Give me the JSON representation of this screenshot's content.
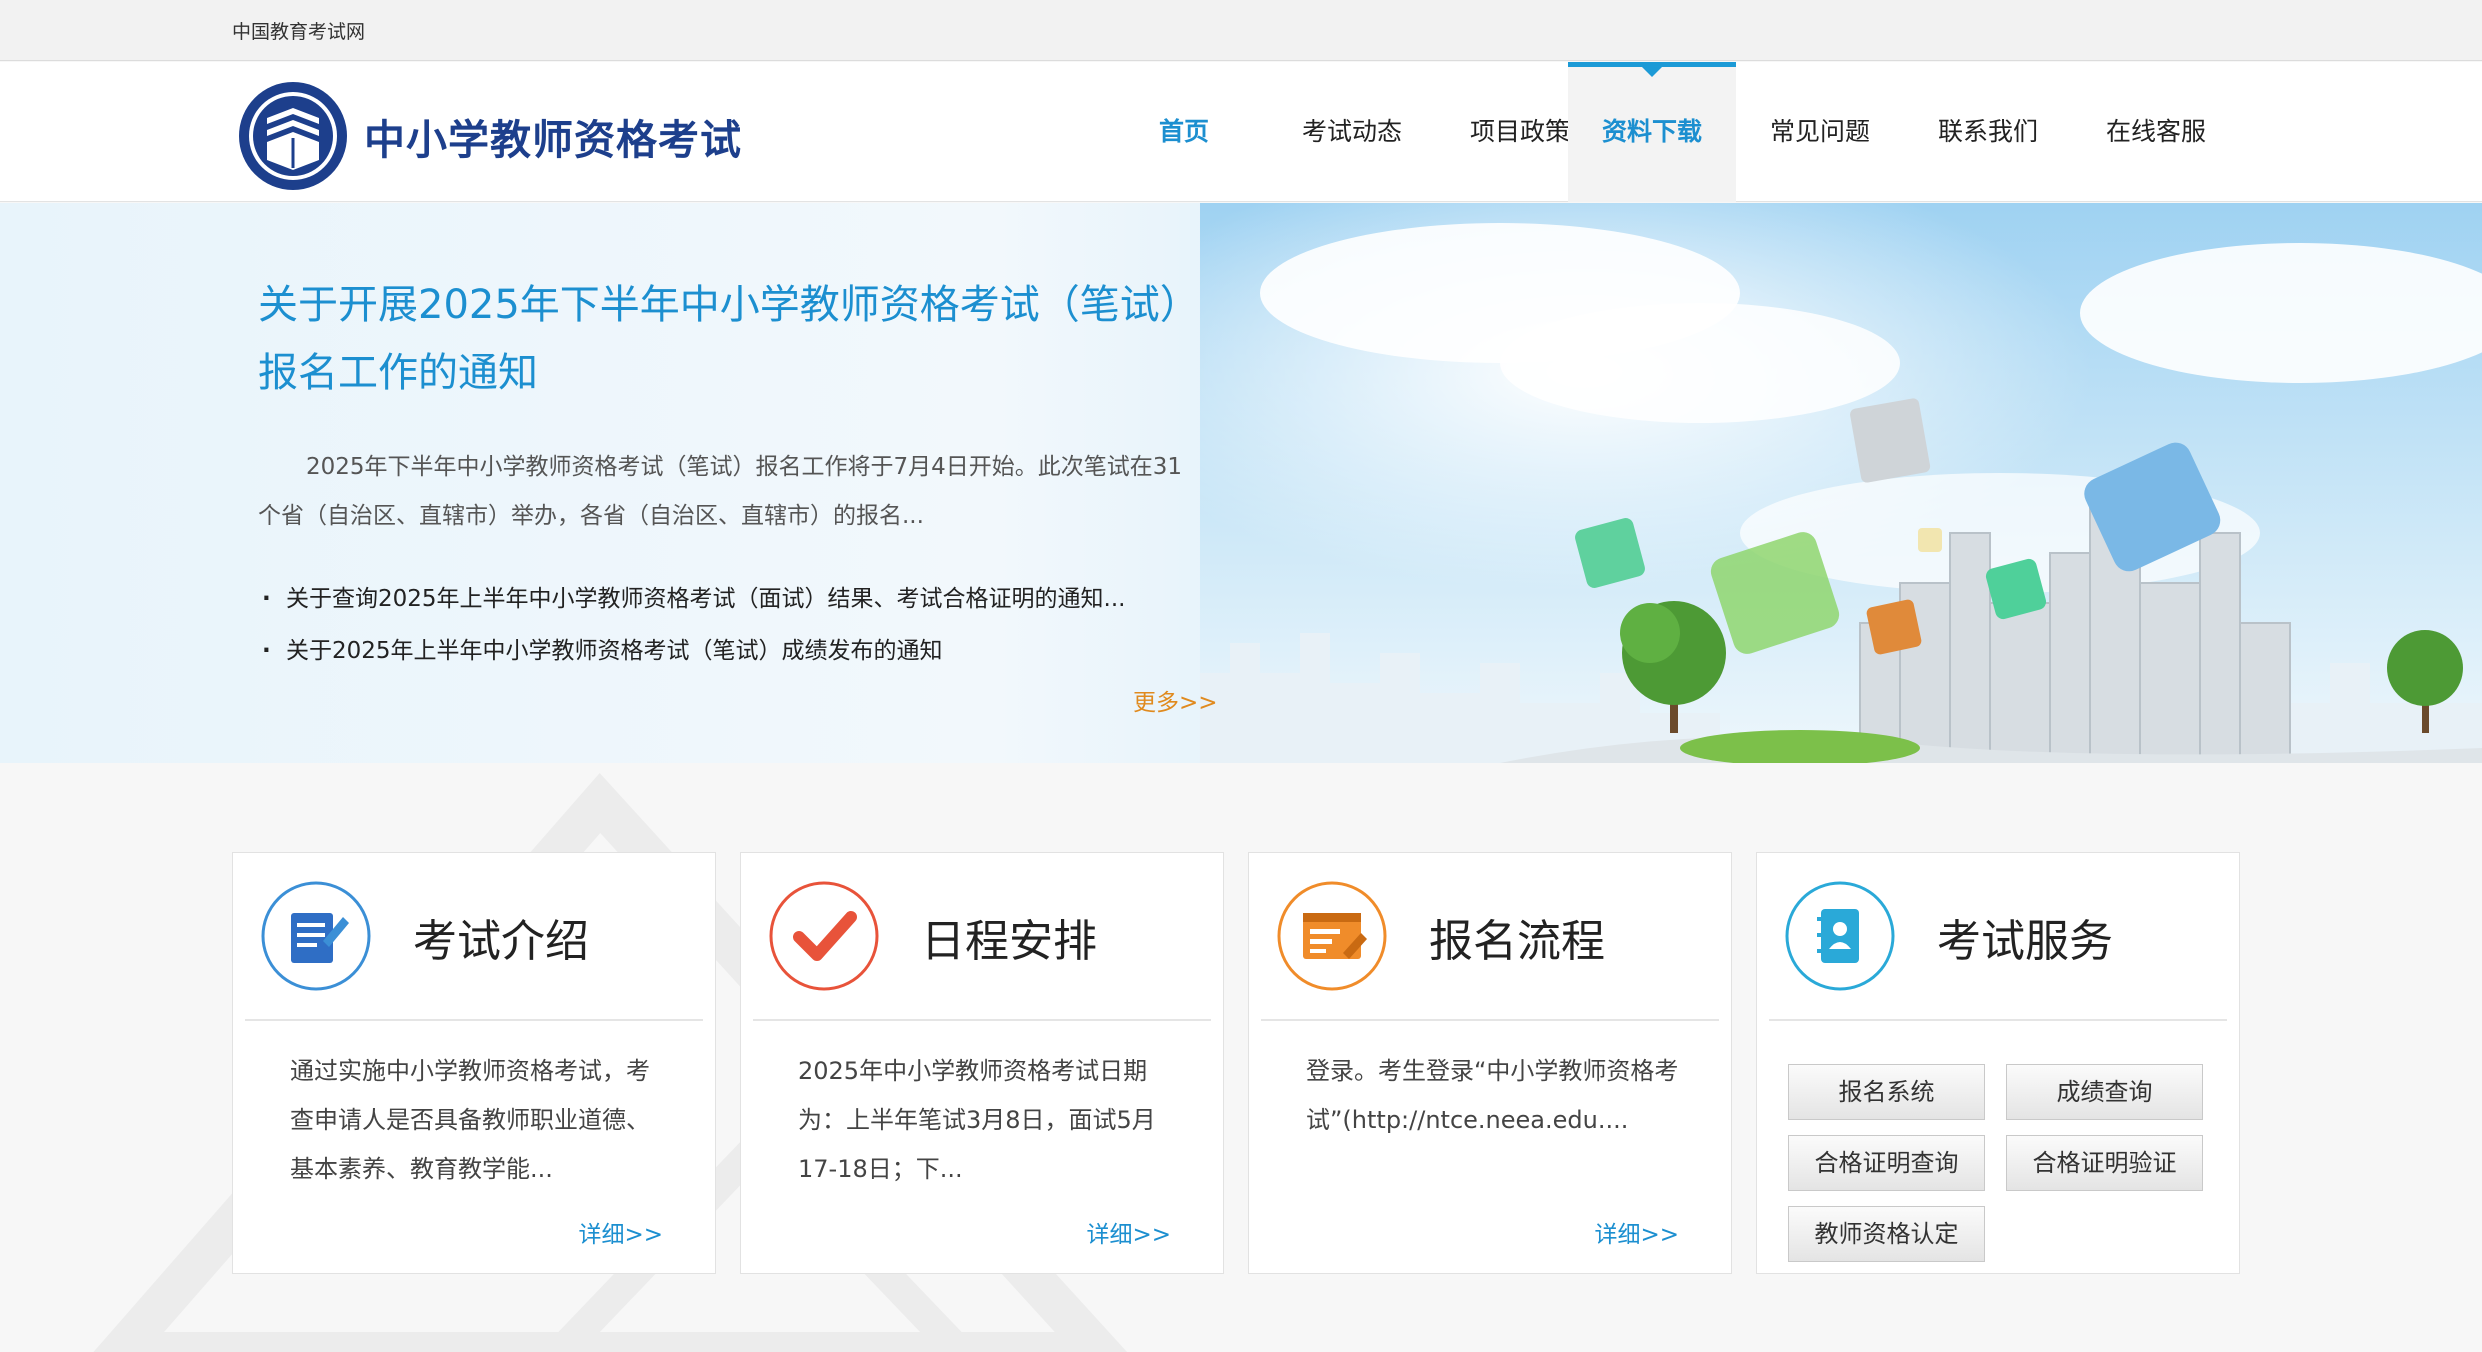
{
  "topbar": {
    "site_name": "中国教育考试网"
  },
  "header": {
    "logo_text": "中小学教师资格考试",
    "nav": [
      {
        "label": "首页"
      },
      {
        "label": "考试动态"
      },
      {
        "label": "项目政策"
      },
      {
        "label": "资料下载"
      },
      {
        "label": "常见问题"
      },
      {
        "label": "联系我们"
      },
      {
        "label": "在线客服"
      }
    ],
    "active_nav": "资料下载"
  },
  "banner": {
    "headline": "关于开展2025年下半年中小学教师资格考试（笔试）报名工作的通知",
    "summary": "2025年下半年中小学教师资格考试（笔试）报名工作将于7月4日开始。此次笔试在31个省（自治区、直辖市）举办，各省（自治区、直辖市）的报名...",
    "news": [
      {
        "text": "关于查询2025年上半年中小学教师资格考试（面试）结果、考试合格证明的通知..."
      },
      {
        "text": "关于2025年上半年中小学教师资格考试（笔试）成绩发布的通知"
      }
    ],
    "more_label": "更多>>"
  },
  "cards": [
    {
      "title": "考试介绍",
      "icon": "document-pen-icon",
      "desc": "通过实施中小学教师资格考试，考查申请人是否具备教师职业道德、基本素养、教育教学能...",
      "detail_label": "详细>>"
    },
    {
      "title": "日程安排",
      "icon": "checkmark-icon",
      "desc": "2025年中小学教师资格考试日期为：上半年笔试3月8日，面试5月17-18日；下...",
      "detail_label": "详细>>"
    },
    {
      "title": "报名流程",
      "icon": "registration-form-icon",
      "desc": "登录。考生登录“中小学教师资格考试”(http://ntce.neea.edu....",
      "detail_label": "详细>>"
    },
    {
      "title": "考试服务",
      "icon": "contact-book-icon",
      "services": [
        {
          "label": "报名系统"
        },
        {
          "label": "成绩查询"
        },
        {
          "label": "合格证明查询"
        },
        {
          "label": "合格证明验证"
        },
        {
          "label": "教师资格认定"
        }
      ]
    }
  ],
  "colors": {
    "accent": "#1c8fd0",
    "nav_active_bar": "#1c9ad6",
    "more_link": "#e08a1e",
    "logo_text": "#1d3f8c",
    "orange_icon": "#f08c2a",
    "red_icon": "#e8533a"
  }
}
